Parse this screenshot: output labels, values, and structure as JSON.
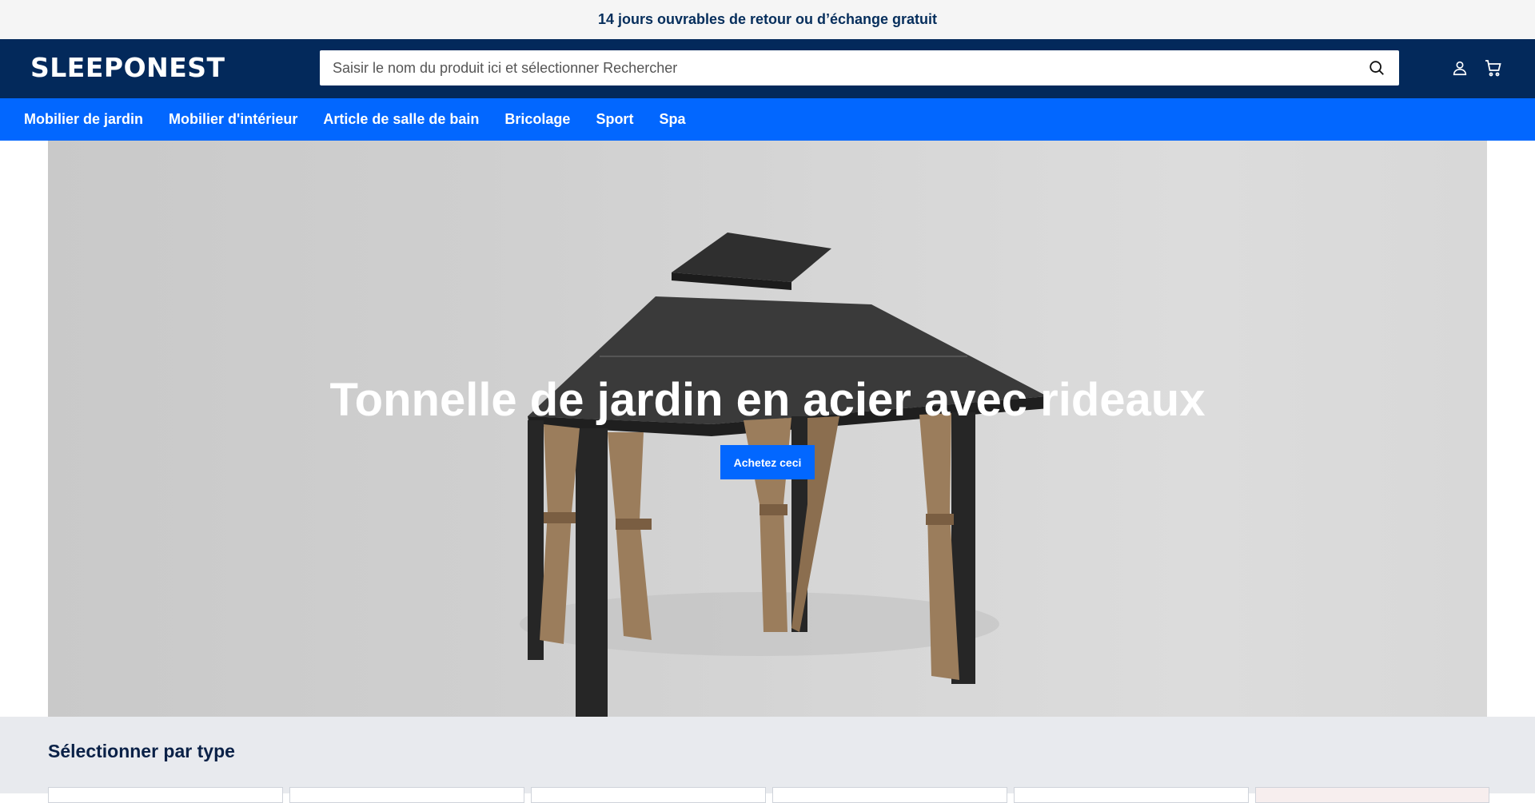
{
  "announcement": "14 jours ouvrables de retour ou d’échange gratuit",
  "header": {
    "logo": "SLEEPONEST",
    "search_placeholder": "Saisir le nom du produit ici et sélectionner Rechercher",
    "icons": [
      "search-icon",
      "user-icon",
      "cart-icon"
    ]
  },
  "nav": {
    "items": [
      "Mobilier de jardin",
      "Mobilier d'intérieur",
      "Article de salle de bain",
      "Bricolage",
      "Sport",
      "Spa"
    ]
  },
  "hero": {
    "title": "Tonnelle de jardin en acier avec rideaux",
    "cta": "Achetez ceci"
  },
  "section": {
    "title": "Sélectionner par type"
  },
  "colors": {
    "announce_bg": "#f5f5f5",
    "header_bg": "#03295b",
    "nav_bg": "#0267ff",
    "cta_bg": "#0267ff"
  }
}
